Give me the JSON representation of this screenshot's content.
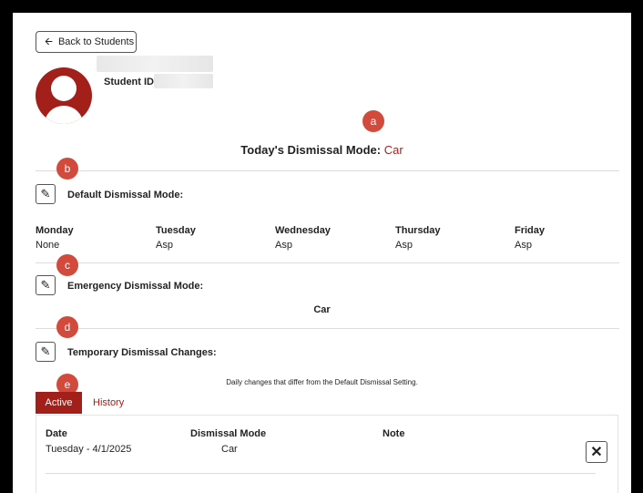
{
  "nav": {
    "back_label": "Back to Students"
  },
  "student": {
    "id_label": "Student ID"
  },
  "markers": {
    "a": "a",
    "b": "b",
    "c": "c",
    "d": "d",
    "e": "e"
  },
  "today": {
    "label": "Today's Dismissal Mode:",
    "value": "Car"
  },
  "default_mode": {
    "label": "Default Dismissal Mode:",
    "days": [
      {
        "name": "Monday",
        "value": "None"
      },
      {
        "name": "Tuesday",
        "value": "Asp"
      },
      {
        "name": "Wednesday",
        "value": "Asp"
      },
      {
        "name": "Thursday",
        "value": "Asp"
      },
      {
        "name": "Friday",
        "value": "Asp"
      }
    ]
  },
  "emergency": {
    "label": "Emergency Dismissal Mode:",
    "value": "Car"
  },
  "temporary": {
    "label": "Temporary Dismissal Changes:",
    "description": "Daily changes that differ from the Default Dismissal Setting.",
    "tabs": {
      "active": "Active",
      "history": "History"
    },
    "columns": {
      "date": "Date",
      "mode": "Dismissal Mode",
      "note": "Note"
    },
    "rows": [
      {
        "date": "Tuesday - 4/1/2025",
        "mode": "Car",
        "note": ""
      }
    ]
  },
  "colors": {
    "accent": "#a31f1a",
    "marker": "#d24a3c"
  },
  "icons": {
    "back": "arrow-left-icon",
    "edit": "pencil-icon",
    "remove": "close-icon",
    "avatar": "user-avatar-icon"
  }
}
